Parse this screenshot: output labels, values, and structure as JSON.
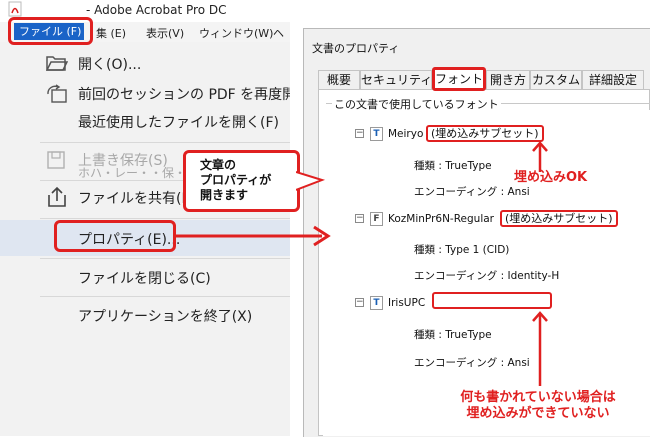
{
  "acrobat": {
    "title": "- Adobe Acrobat Pro DC",
    "app_icon": "acrobat-icon",
    "menubar": [
      {
        "label": "ファイル (F)"
      },
      {
        "label": "集 (E)"
      },
      {
        "label": "表示(V)"
      },
      {
        "label": "ウィンドウ(W)"
      },
      {
        "label": "ヘ"
      }
    ],
    "file_menu": {
      "open": "開く(O)...",
      "reopen_session": "前回のセッションの PDF を再度開く",
      "recent": "最近使用したファイルを開く(F)",
      "overwrite": "上書き保存(S)",
      "overwrite_ghost": "ホハ・レー・・保・",
      "share": "ファイルを共有(L)",
      "properties": "プロパティ(E)...",
      "close": "ファイルを閉じる(C)",
      "quit": "アプリケーションを終了(X)"
    }
  },
  "callout": {
    "line1": "文章の",
    "line2": "プロパティが",
    "line3": "開きます"
  },
  "dialog": {
    "title": "文書のプロパティ",
    "tabs": [
      "概要",
      "セキュリティ",
      "フォント",
      "開き方",
      "カスタム",
      "詳細設定"
    ],
    "active_tab": "フォント",
    "section_label": "この文書で使用しているフォント",
    "fonts": [
      {
        "name": "Meiryo",
        "embed_status": "(埋め込みサブセット)",
        "type_label": "種類 : TrueType",
        "encoding_label": "エンコーディング : Ansi",
        "icon": "truetype-font-icon"
      },
      {
        "name": "KozMinPr6N-Regular",
        "embed_status": "(埋め込みサブセット)",
        "type_label": "種類 : Type 1 (CID)",
        "encoding_label": "エンコーディング : Identity-H",
        "icon": "type1-font-icon"
      },
      {
        "name": "IrisUPC",
        "embed_status": "",
        "type_label": "種類 : TrueType",
        "encoding_label": "エンコーディング : Ansi",
        "icon": "truetype-font-icon"
      }
    ]
  },
  "annotations": {
    "embedded_ok": "埋め込みOK",
    "not_embedded_line1": "何も書かれていない場合は",
    "not_embedded_line2": "埋め込みができていない",
    "accent_color": "#e02020"
  }
}
